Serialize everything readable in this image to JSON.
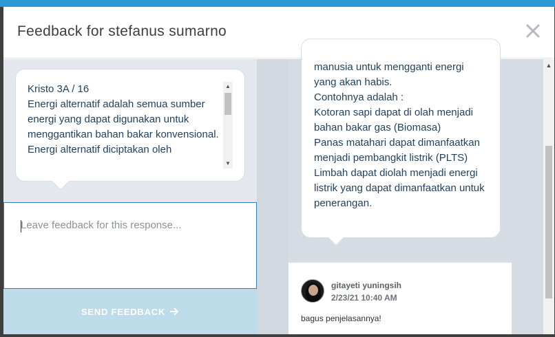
{
  "modal": {
    "title": "Feedback for stefanus sumarno"
  },
  "left": {
    "response_text": "Kristo 3A / 16\nEnergi alternatif adalah semua sumber energi yang dapat digunakan untuk menggantikan bahan bakar konvensional.\nEnergi alternatif diciptakan oleh",
    "feedback_placeholder": "Leave feedback for this response...",
    "send_label": "SEND FEEDBACK"
  },
  "right": {
    "response_text": "manusia untuk mengganti energi\nyang akan habis.\nContohnya adalah :\nKotoran sapi dapat di olah menjadi bahan bakar gas (Biomasa)\nPanas matahari dapat dimanfaatkan menjadi pembangkit listrik (PLTS)\nLimbah dapat diolah menjadi energi listrik yang dapat dimanfaatkan untuk penerangan.",
    "comment": {
      "author": "gitayeti yuningsih",
      "timestamp": "2/23/21 10:40 AM",
      "text": "bagus penjelasannya!"
    }
  },
  "colors": {
    "accent": "#2d9ad6",
    "send_button_bg": "#bddbe9",
    "text_primary": "#1f3f5e"
  },
  "icons": {
    "close": "close-icon",
    "send_arrow": "arrow-right-icon"
  }
}
